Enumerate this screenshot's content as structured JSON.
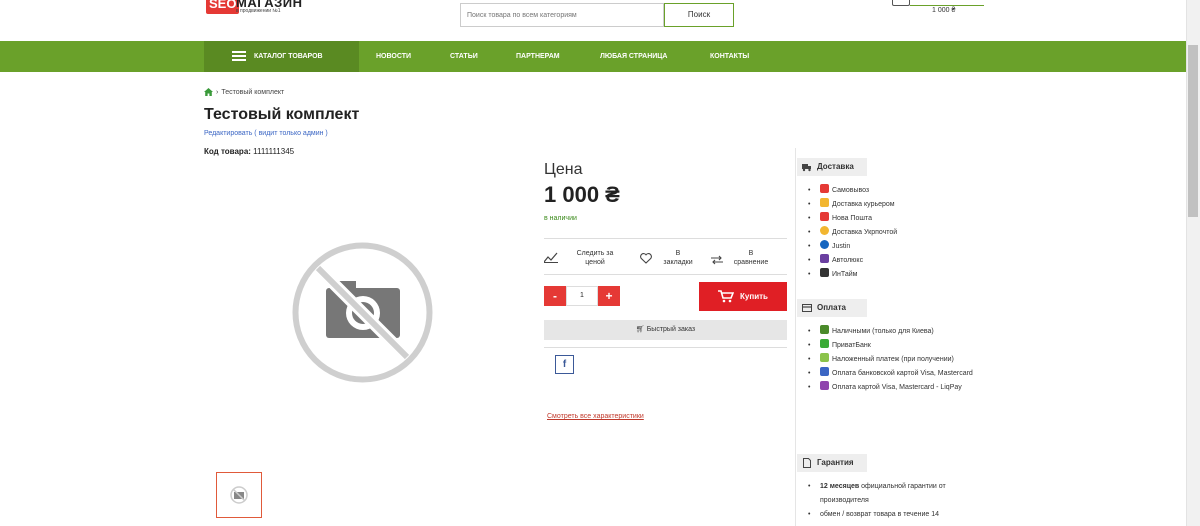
{
  "header": {
    "logo_seo": "SEO",
    "logo_name": "МАГАЗИН",
    "logo_tagline": "в продвижении №1",
    "search_placeholder": "Поиск товара по всем категориям",
    "search_button": "Поиск",
    "cart_total": "1 000 ₴"
  },
  "nav": {
    "catalog": "КАТАЛОГ ТОВАРОВ",
    "items": [
      "НОВОСТИ",
      "СТАТЬИ",
      "ПАРТНЕРАМ",
      "ЛЮБАЯ СТРАНИЦА",
      "КОНТАКТЫ"
    ]
  },
  "breadcrumb": {
    "current": "Тестовый комплект"
  },
  "product": {
    "title": "Тестовый комплект",
    "edit_link": "Редактировать ( видит только админ )",
    "code_label": "Код товара:",
    "code_value": "1111111345",
    "price_label": "Цена",
    "price": "1 000 ₴",
    "stock": "в наличии",
    "actions": {
      "track_1": "Следить за",
      "track_2": "ценой",
      "bookmark_1": "В",
      "bookmark_2": "закладки",
      "compare_1": "В",
      "compare_2": "сравнение"
    },
    "qty_minus": "-",
    "qty_value": "1",
    "qty_plus": "+",
    "buy_button": "Купить",
    "fast_order": "Быстрый заказ",
    "facebook": "f",
    "all_characteristics": "Смотреть все характеристики"
  },
  "sidebar": {
    "delivery": {
      "title": "Доставка",
      "items": [
        "Самовывоз",
        "Доставка курьером",
        "Нова Пошта",
        "Доставка Укрпочтой",
        "Justin",
        "Автолюкс",
        "ИнТайм"
      ],
      "colors": [
        "#e53935",
        "#f2b630",
        "#e53935",
        "#f2b630",
        "#1565c0",
        "#6a3fa0",
        "#333333"
      ]
    },
    "payment": {
      "title": "Оплата",
      "items": [
        "Наличными (только для Киева)",
        "ПриватБанк",
        "Наложенный платеж (при получении)",
        "Оплата банковской картой Visa, Mastercard",
        "Оплата картой Visa, Mastercard - LiqPay"
      ],
      "colors": [
        "#4a8a2a",
        "#3aaa35",
        "#8bc34a",
        "#3b66c4",
        "#8e44ad"
      ]
    },
    "warranty": {
      "title": "Гарантия",
      "item1_bold": "12 месяцев",
      "item1_rest": " официальной гарантии от производителя",
      "item2": "обмен / возврат товара в течение 14"
    }
  },
  "colors": {
    "brand_green": "#6aa12a",
    "accent_red": "#e53935"
  }
}
